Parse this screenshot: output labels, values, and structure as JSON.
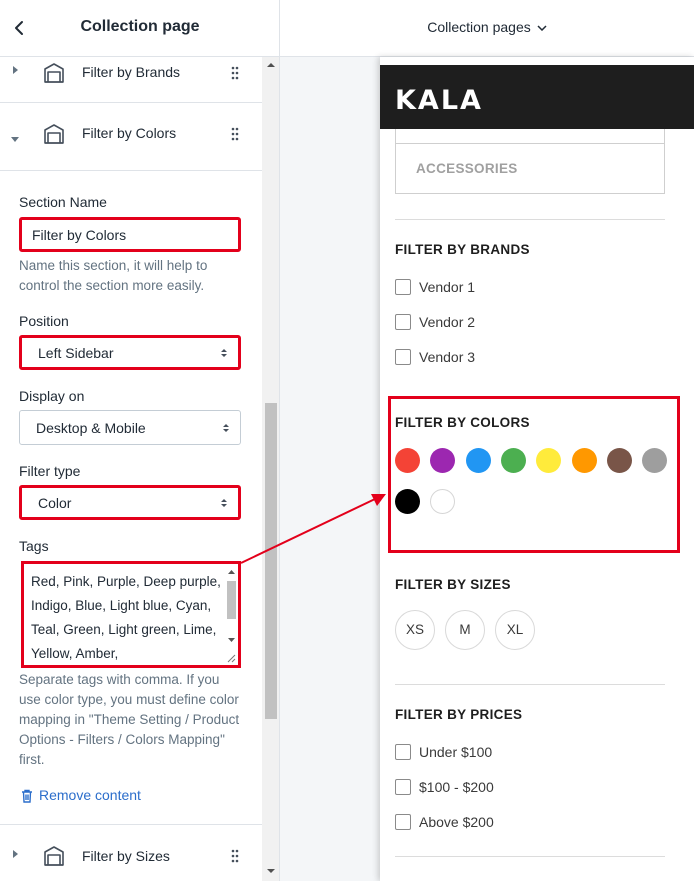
{
  "editor": {
    "title": "Collection page",
    "sections": [
      {
        "label": "Filter by Brands"
      },
      {
        "label": "Filter by Colors"
      },
      {
        "label": "Filter by Sizes"
      }
    ],
    "section_name_label": "Section Name",
    "section_name_value": "Filter by Colors",
    "section_name_help": "Name this section, it will help to control the section more easily.",
    "position_label": "Position",
    "position_value": "Left Sidebar",
    "display_on_label": "Display on",
    "display_on_value": "Desktop & Mobile",
    "filter_type_label": "Filter type",
    "filter_type_value": "Color",
    "tags_label": "Tags",
    "tags_value": "Red, Pink, Purple, Deep purple, Indigo, Blue, Light blue, Cyan, Teal, Green, Light green, Lime, Yellow, Amber,",
    "tags_help": "Separate tags with comma. If you use color type, you must define color mapping in \"Theme Setting / Product Options - Filters / Colors Mapping\" first.",
    "remove_label": "Remove content"
  },
  "topbar": {
    "page_selector": "Collection pages"
  },
  "preview": {
    "logo": "KALA",
    "category": "ACCESSORIES",
    "brands": {
      "heading": "FILTER BY BRANDS",
      "items": [
        "Vendor 1",
        "Vendor 2",
        "Vendor 3"
      ]
    },
    "colors": {
      "heading": "FILTER BY COLORS",
      "swatches": [
        "#f44336",
        "#9c27b0",
        "#2196f3",
        "#4caf50",
        "#ffeb3b",
        "#ff9800",
        "#795548",
        "#9e9e9e",
        "#000000",
        "#ffffff"
      ]
    },
    "sizes": {
      "heading": "FILTER BY SIZES",
      "items": [
        "XS",
        "M",
        "XL"
      ]
    },
    "prices": {
      "heading": "FILTER BY PRICES",
      "items": [
        "Under $100",
        "$100 - $200",
        "Above $200"
      ]
    }
  },
  "colors": {
    "highlight": "#e3001b",
    "link": "#2c6ecb",
    "header_bg": "#1e1e1e"
  }
}
